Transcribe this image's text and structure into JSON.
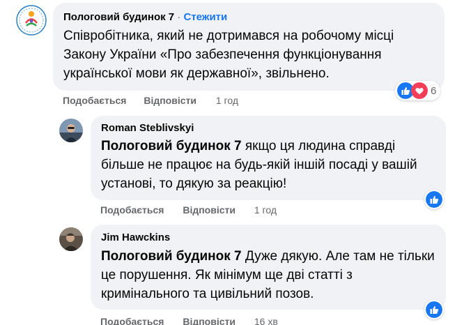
{
  "comments": [
    {
      "author": "Пологовий будинок 7",
      "separator": "·",
      "follow_label": "Стежити",
      "text": "Співробітника, який не дотримався на робочому місці Закону України «Про забезпечення функціонування української мови як державної», звільнено.",
      "like_label": "Подобається",
      "reply_label": "Відповісти",
      "time": "1 год",
      "reaction_count": "6",
      "reactions": [
        "like-icon",
        "love-icon"
      ]
    },
    {
      "author": "Roman Steblivskyi",
      "mention": "Пологовий будинок 7",
      "text": " якщо ця людина справді більше не працює на будь-якій іншій посаді у вашій установі, то дякую за реакцію!",
      "like_label": "Подобається",
      "reply_label": "Відповісти",
      "time": "1 год",
      "reactions": [
        "like-icon"
      ]
    },
    {
      "author": "Jim Hawckins",
      "mention": "Пологовий будинок 7",
      "text": " Дуже дякую. Але там не тільки це порушення. Як мінімум ще дві статті з кримінального та цивільний позов.",
      "like_label": "Подобається",
      "reply_label": "Відповісти",
      "time": "16 хв",
      "reactions": [
        "like-icon"
      ]
    }
  ],
  "colors": {
    "bubble": "#f0f2f5",
    "link": "#1877f2",
    "muted": "#65676b",
    "like": "#1877f2",
    "love": "#f33e58"
  }
}
